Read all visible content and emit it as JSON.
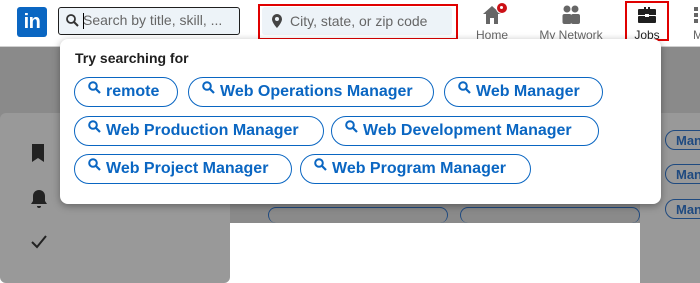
{
  "nav": {
    "logo_text": "in",
    "search": {
      "placeholder": "Search by title, skill, ...",
      "value": ""
    },
    "location": {
      "placeholder": "City, state, or zip code",
      "value": ""
    },
    "items": [
      {
        "label": "Home",
        "icon": "home-icon"
      },
      {
        "label": "My Network",
        "icon": "network-icon"
      },
      {
        "label": "Jobs",
        "icon": "briefcase-icon"
      },
      {
        "label": "M",
        "icon": "grid-icon"
      }
    ]
  },
  "dropdown": {
    "title": "Try searching for",
    "suggestions": [
      "remote",
      "Web Operations Manager",
      "Web Manager",
      "Web Production Manager",
      "Web Development Manager",
      "Web Project Manager",
      "Web Program Manager"
    ]
  },
  "background": {
    "right_pills": [
      "Manag",
      "Manag",
      "Manag"
    ]
  },
  "colors": {
    "brand_blue": "#0a66c2",
    "highlight_red": "#e00000",
    "notification_red": "#cc1016"
  }
}
